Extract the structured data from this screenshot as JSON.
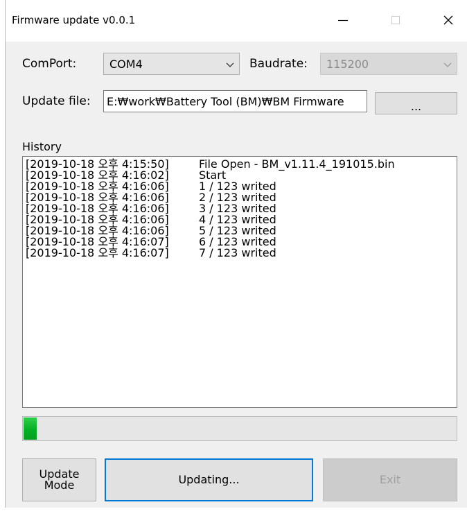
{
  "window": {
    "title": "Firmware update v0.0.1"
  },
  "comport": {
    "label": "ComPort:",
    "value": "COM4"
  },
  "baudrate": {
    "label": "Baudrate:",
    "value": "115200"
  },
  "update_file": {
    "label": "Update file:",
    "value": "E:₩work₩Battery Tool (BM)₩BM Firmware",
    "browse_label": "..."
  },
  "history": {
    "label": "History",
    "rows": [
      {
        "ts": "[2019-10-18 오후 4:15:50]",
        "msg": "File Open - BM_v1.11.4_191015.bin"
      },
      {
        "ts": "[2019-10-18 오후 4:16:02]",
        "msg": "Start"
      },
      {
        "ts": "[2019-10-18 오후 4:16:06]",
        "msg": "1 / 123 writed"
      },
      {
        "ts": "[2019-10-18 오후 4:16:06]",
        "msg": "2 / 123 writed"
      },
      {
        "ts": "[2019-10-18 오후 4:16:06]",
        "msg": "3 / 123 writed"
      },
      {
        "ts": "[2019-10-18 오후 4:16:06]",
        "msg": "4 / 123 writed"
      },
      {
        "ts": "[2019-10-18 오후 4:16:06]",
        "msg": "5 / 123 writed"
      },
      {
        "ts": "[2019-10-18 오후 4:16:07]",
        "msg": "6 / 123 writed"
      },
      {
        "ts": "[2019-10-18 오후 4:16:07]",
        "msg": "7 / 123 writed"
      }
    ]
  },
  "progress": {
    "percent": 3,
    "color": "#06b025"
  },
  "buttons": {
    "update_mode_line1": "Update",
    "update_mode_line2": "Mode",
    "updating": "Updating...",
    "exit": "Exit"
  },
  "colors": {
    "focus_border": "#0078d7",
    "window_bg": "#f0f0f0"
  }
}
